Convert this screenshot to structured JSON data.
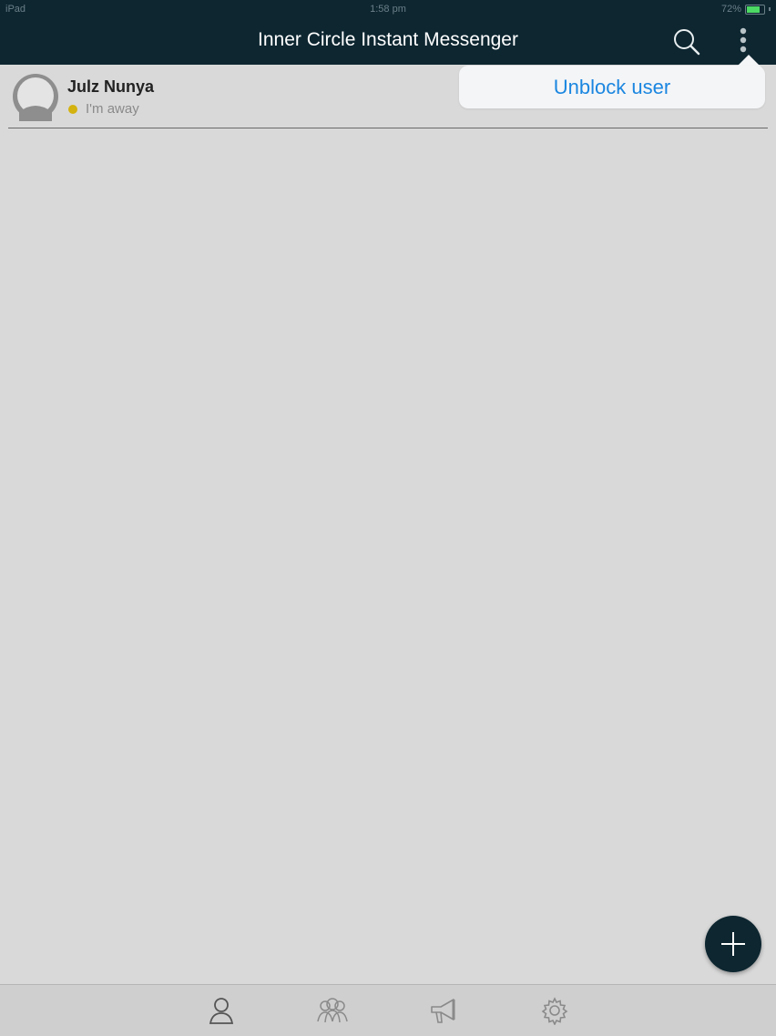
{
  "status_bar": {
    "device": "iPad",
    "time": "1:58 pm",
    "battery": "72%",
    "battery_level": 0.72
  },
  "header": {
    "title": "Inner Circle Instant Messenger",
    "search_icon": "search-icon",
    "more_icon": "more-vertical-icon"
  },
  "contacts": [
    {
      "name": "Julz Nunya",
      "status_text": "I'm away",
      "status_color": "#d4b20f"
    }
  ],
  "popup_menu": {
    "items": [
      {
        "label": "Unblock user"
      }
    ]
  },
  "fab": {
    "icon": "plus-icon"
  },
  "tabbar": {
    "tabs": [
      {
        "icon": "contacts-icon",
        "active": true
      },
      {
        "icon": "groups-icon",
        "active": false
      },
      {
        "icon": "broadcast-icon",
        "active": false
      },
      {
        "icon": "settings-icon",
        "active": false
      }
    ]
  },
  "colors": {
    "header_bg": "#0d2630",
    "background": "#d9d9d9",
    "link": "#1a86e0",
    "away": "#d4b20f"
  }
}
